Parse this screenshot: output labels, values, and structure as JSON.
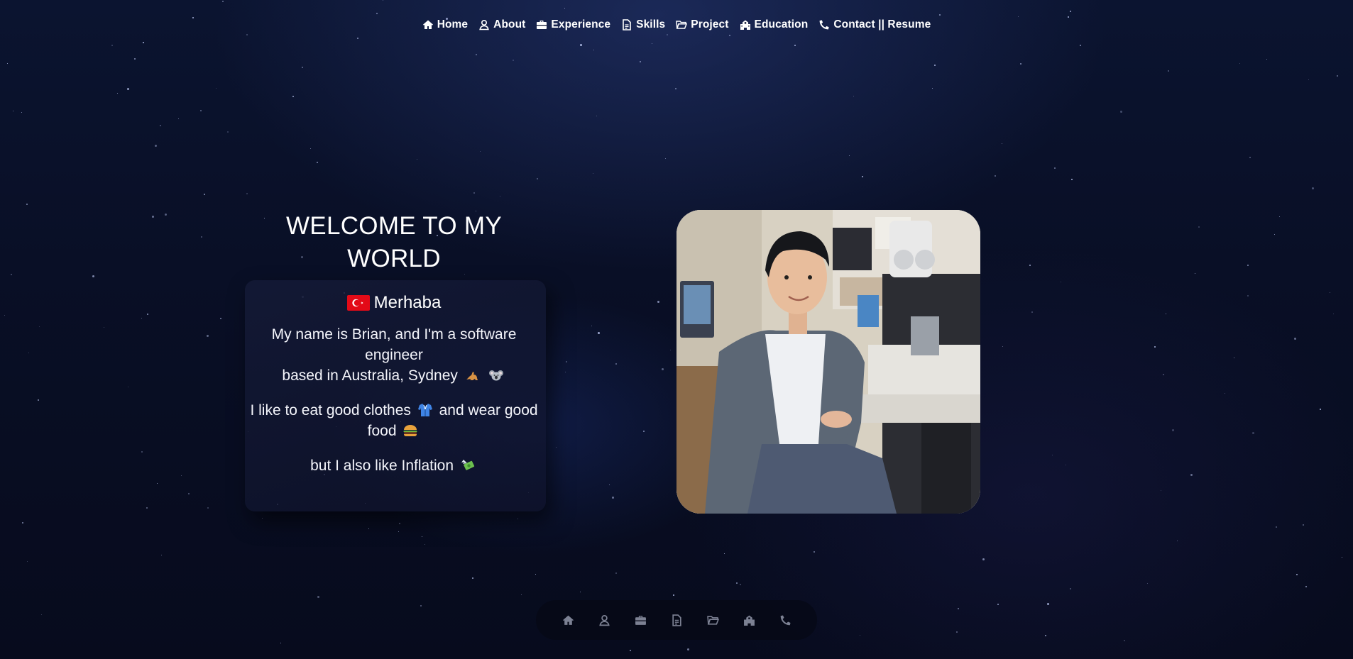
{
  "nav": {
    "items": [
      {
        "label": "Home",
        "icon": "home-icon"
      },
      {
        "label": "About",
        "icon": "user-icon"
      },
      {
        "label": "Experience",
        "icon": "briefcase-icon"
      },
      {
        "label": "Skills",
        "icon": "file-icon"
      },
      {
        "label": "Project",
        "icon": "folder-icon"
      },
      {
        "label": "Education",
        "icon": "school-icon"
      },
      {
        "label": "Contact || Resume",
        "icon": "phone-icon"
      }
    ]
  },
  "hero": {
    "title": "WELCOME TO MY WORLD",
    "greeting": "Merhaba",
    "flag": "turkey-flag-icon",
    "intro_line1": "My name is Brian, and I'm a software engineer",
    "intro_line2": "based in Australia, Sydney",
    "intro_emojis": [
      "kangaroo-icon",
      "koala-icon"
    ],
    "line2": "I like to eat good clothes",
    "line2_emoji": "shirt-icon",
    "line2_tail": "and wear good food",
    "line2_tail_emoji": "burger-icon",
    "line3": "but I also like Inflation",
    "line3_emoji": "money-wings-icon"
  },
  "photo": {
    "alt": "portrait-photo",
    "icon": "person-photo"
  },
  "bottom_nav": {
    "icons": [
      "home-icon",
      "user-icon",
      "briefcase-icon",
      "file-icon",
      "folder-icon",
      "school-icon",
      "phone-icon"
    ]
  },
  "colors": {
    "background": "#090f26",
    "text": "#ffffff",
    "card": "#161c3a"
  }
}
